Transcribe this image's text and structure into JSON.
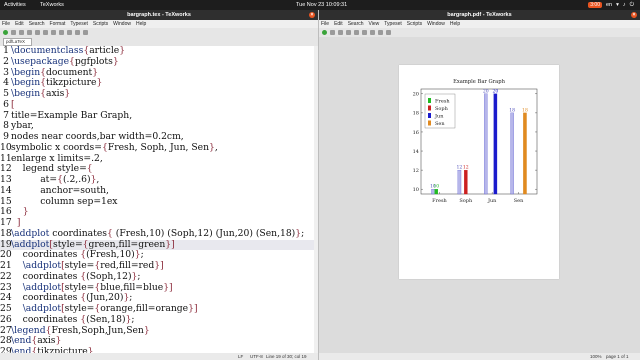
{
  "topbar": {
    "activities": "Activities",
    "app": "TeXworks",
    "clock": "Tue Nov 23  10:09:31",
    "badge": "3:00",
    "lang": "en"
  },
  "left_window": {
    "title": "bargraph.tex - TeXworks",
    "menu": [
      "File",
      "Edit",
      "Search",
      "Format",
      "Typeset",
      "Scripts",
      "Window",
      "Help"
    ],
    "engine": "pdfLaTeX",
    "lines": [
      {
        "n": "1",
        "code": "\\documentclass{article}"
      },
      {
        "n": "2",
        "code": "\\usepackage{pgfplots}"
      },
      {
        "n": "3",
        "code": "\\begin{document}"
      },
      {
        "n": "4",
        "code": "\\begin{tikzpicture}"
      },
      {
        "n": "5",
        "code": "\\begin{axis}"
      },
      {
        "n": "6",
        "code": "["
      },
      {
        "n": "7",
        "code": "title=Example Bar Graph,"
      },
      {
        "n": "8",
        "code": "ybar,"
      },
      {
        "n": "9",
        "code": "nodes near coords,bar width=0.2cm,"
      },
      {
        "n": "10",
        "code": "symbolic x coords={Fresh, Soph, Jun, Sen},"
      },
      {
        "n": "11",
        "code": "enlarge x limits=.2,"
      },
      {
        "n": "12",
        "code": "    legend style={"
      },
      {
        "n": "13",
        "code": "          at={(.2,.6)},"
      },
      {
        "n": "14",
        "code": "          anchor=south,"
      },
      {
        "n": "15",
        "code": "          column sep=1ex"
      },
      {
        "n": "16",
        "code": "    }"
      },
      {
        "n": "17",
        "code": "  ]"
      },
      {
        "n": "18",
        "code": "\\addplot coordinates{ (Fresh,10) (Soph,12) (Jun,20) (Sen,18)};"
      },
      {
        "n": "19",
        "code": "\\addplot[style={green,fill=green}]"
      },
      {
        "n": "20",
        "code": "    coordinates {(Fresh,10)};"
      },
      {
        "n": "21",
        "code": "    \\addplot[style={red,fill=red}]"
      },
      {
        "n": "22",
        "code": "    coordinates {(Soph,12)};"
      },
      {
        "n": "23",
        "code": "    \\addplot[style={blue,fill=blue}]"
      },
      {
        "n": "24",
        "code": "    coordinates {(Jun,20)};"
      },
      {
        "n": "25",
        "code": "    \\addplot[style={orange,fill=orange}]"
      },
      {
        "n": "26",
        "code": "    coordinates {(Sen,18)};"
      },
      {
        "n": "27",
        "code": "\\legend{Fresh,Soph,Jun,Sen}"
      },
      {
        "n": "28",
        "code": "\\end{axis}"
      },
      {
        "n": "29",
        "code": "\\end{tikzpicture}"
      }
    ],
    "status": {
      "eol": "LF",
      "enc": "UTF-8",
      "pos": "Line 19 of 30; col 19"
    }
  },
  "right_window": {
    "title": "bargraph.pdf - TeXworks",
    "menu": [
      "File",
      "Edit",
      "Search",
      "View",
      "Typeset",
      "Scripts",
      "Window",
      "Help"
    ],
    "status": {
      "zoom": "100%",
      "page": "page 1 of 1"
    }
  },
  "chart_data": {
    "type": "bar",
    "title": "Example Bar Graph",
    "categories": [
      "Fresh",
      "Soph",
      "Jun",
      "Sen"
    ],
    "series": [
      {
        "values": [
          10,
          12,
          20,
          18
        ],
        "color": "#a9a9e6"
      },
      {
        "name": "Fresh",
        "values": [
          10,
          null,
          null,
          null
        ],
        "color": "#22bb22"
      },
      {
        "name": "Soph",
        "values": [
          null,
          12,
          null,
          null
        ],
        "color": "#cc2020"
      },
      {
        "name": "Jun",
        "values": [
          null,
          null,
          20,
          null
        ],
        "color": "#1a1acc"
      },
      {
        "name": "Sen",
        "values": [
          null,
          null,
          null,
          18
        ],
        "color": "#e08a20"
      }
    ],
    "yticks": [
      10,
      12,
      14,
      16,
      18,
      20
    ],
    "ylim": [
      9.5,
      20.5
    ],
    "legend_position": "left-middle",
    "data_labels": true,
    "xlabel": "",
    "ylabel": ""
  }
}
